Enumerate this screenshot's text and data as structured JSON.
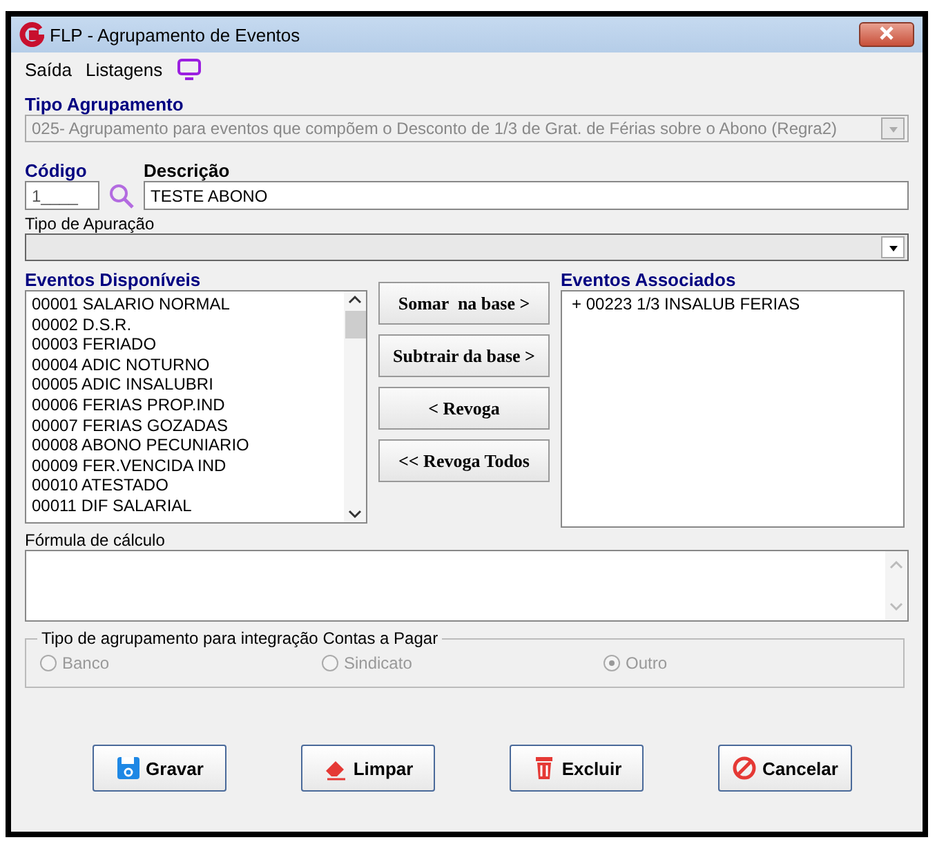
{
  "window": {
    "title": "FLP - Agrupamento de Eventos"
  },
  "menu": [
    "Saída",
    "Listagens"
  ],
  "tipo_agrupamento": {
    "label": "Tipo Agrupamento",
    "value": "025-  Agrupamento para eventos que compõem o Desconto de 1/3 de Grat. de Férias sobre o Abono (Regra2)",
    "disabled": true
  },
  "codigo": {
    "label": "Código",
    "value": "1____"
  },
  "descricao": {
    "label": "Descrição",
    "value": "TESTE ABONO"
  },
  "tipo_apuracao": {
    "label": "Tipo de Apuração"
  },
  "eventos_disponiveis": {
    "title": "Eventos Disponíveis",
    "items": [
      "00001 SALARIO NORMAL",
      "00002 D.S.R.",
      "00003 FERIADO",
      "00004 ADIC NOTURNO",
      "00005 ADIC INSALUBRI",
      "00006 FERIAS PROP.IND",
      "00007 FERIAS GOZADAS",
      "00008 ABONO PECUNIARIO",
      "00009 FER.VENCIDA IND",
      "00010 ATESTADO",
      "00011 DIF SALARIAL"
    ]
  },
  "transfer_buttons": [
    "Somar  na base >",
    "Subtrair da base >",
    "< Revoga",
    "<< Revoga Todos"
  ],
  "eventos_associados": {
    "title": "Eventos Associados",
    "items": [
      "+ 00223 1/3 INSALUB FERIAS"
    ]
  },
  "formula": {
    "label": "Fórmula de cálculo"
  },
  "integracao": {
    "title": "Tipo de agrupamento para integração Contas a Pagar",
    "disabled": true,
    "options": [
      {
        "label": "Banco",
        "selected": false
      },
      {
        "label": "Sindicato",
        "selected": false
      },
      {
        "label": "Outro",
        "selected": true
      }
    ]
  },
  "buttons": [
    {
      "label": "Gravar",
      "kind": "save"
    },
    {
      "label": "Limpar",
      "kind": "clear"
    },
    {
      "label": "Excluir",
      "kind": "delete"
    },
    {
      "label": "Cancelar",
      "kind": "cancel"
    }
  ]
}
